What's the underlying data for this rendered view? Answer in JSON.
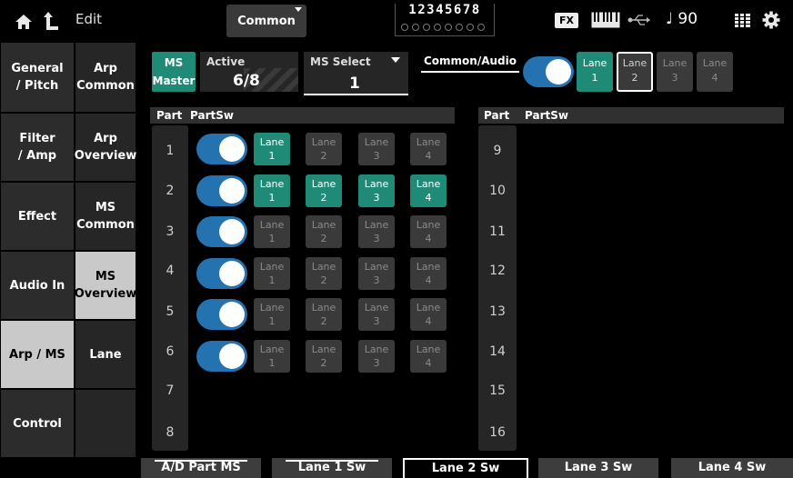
{
  "topbar": {
    "edit_label": "Edit",
    "common_label": "Common",
    "part_digits": "12345678",
    "fx_label": "FX",
    "tempo": "♩ 90"
  },
  "nav": {
    "col1": [
      {
        "label": "General\n/ Pitch",
        "active": false
      },
      {
        "label": "Filter\n/ Amp",
        "active": false
      },
      {
        "label": "Effect",
        "active": false
      },
      {
        "label": "Audio In",
        "active": false
      },
      {
        "label": "Arp / MS",
        "active": true
      },
      {
        "label": "Control",
        "active": false
      }
    ],
    "col2": [
      {
        "label": "Arp\nCommon",
        "active": false
      },
      {
        "label": "Arp\nOverview",
        "active": false
      },
      {
        "label": "MS\nCommon",
        "active": false
      },
      {
        "label": "MS\nOverview",
        "active": true
      },
      {
        "label": "Lane",
        "active": false
      }
    ]
  },
  "header": {
    "ms_master_label": "MS\nMaster",
    "active_caption": "Active",
    "active_value": "6/8",
    "ms_select_caption": "MS Select",
    "ms_select_value": "1",
    "common_audio_label": "Common/Audio",
    "common_audio_switch": "on",
    "lanes": [
      {
        "label": "Lane",
        "num": "1",
        "state": "on"
      },
      {
        "label": "Lane",
        "num": "2",
        "state": "selected"
      },
      {
        "label": "Lane",
        "num": "3",
        "state": "off"
      },
      {
        "label": "Lane",
        "num": "4",
        "state": "off"
      }
    ]
  },
  "table": {
    "part_header": "Part",
    "partsw_header": "PartSw",
    "left_parts": [
      "1",
      "2",
      "3",
      "4",
      "5",
      "6",
      "7",
      "8"
    ],
    "right_parts": [
      "9",
      "10",
      "11",
      "12",
      "13",
      "14",
      "15",
      "16"
    ],
    "rows": [
      {
        "switch": "on",
        "lanes": [
          {
            "label": "Lane",
            "num": "1",
            "on": true
          },
          {
            "label": "Lane",
            "num": "2",
            "on": false
          },
          {
            "label": "Lane",
            "num": "3",
            "on": false
          },
          {
            "label": "Lane",
            "num": "4",
            "on": false
          }
        ]
      },
      {
        "switch": "on",
        "lanes": [
          {
            "label": "Lane",
            "num": "1",
            "on": true
          },
          {
            "label": "Lane",
            "num": "2",
            "on": true
          },
          {
            "label": "Lane",
            "num": "3",
            "on": true
          },
          {
            "label": "Lane",
            "num": "4",
            "on": true
          }
        ]
      },
      {
        "switch": "on",
        "lanes": [
          {
            "label": "Lane",
            "num": "1",
            "on": false
          },
          {
            "label": "Lane",
            "num": "2",
            "on": false
          },
          {
            "label": "Lane",
            "num": "3",
            "on": false
          },
          {
            "label": "Lane",
            "num": "4",
            "on": false
          }
        ]
      },
      {
        "switch": "on",
        "lanes": [
          {
            "label": "Lane",
            "num": "1",
            "on": false
          },
          {
            "label": "Lane",
            "num": "2",
            "on": false
          },
          {
            "label": "Lane",
            "num": "3",
            "on": false
          },
          {
            "label": "Lane",
            "num": "4",
            "on": false
          }
        ]
      },
      {
        "switch": "on",
        "lanes": [
          {
            "label": "Lane",
            "num": "1",
            "on": false
          },
          {
            "label": "Lane",
            "num": "2",
            "on": false
          },
          {
            "label": "Lane",
            "num": "3",
            "on": false
          },
          {
            "label": "Lane",
            "num": "4",
            "on": false
          }
        ]
      },
      {
        "switch": "on",
        "lanes": [
          {
            "label": "Lane",
            "num": "1",
            "on": false
          },
          {
            "label": "Lane",
            "num": "2",
            "on": false
          },
          {
            "label": "Lane",
            "num": "3",
            "on": false
          },
          {
            "label": "Lane",
            "num": "4",
            "on": false
          }
        ]
      }
    ]
  },
  "tabs": [
    {
      "label": "A/D Part MS",
      "active": false
    },
    {
      "label": "Lane 1 Sw",
      "active": false
    },
    {
      "label": "Lane 2 Sw",
      "active": true
    },
    {
      "label": "Lane 3 Sw",
      "active": false
    },
    {
      "label": "Lane 4 Sw",
      "active": false
    }
  ],
  "colors": {
    "accent_teal": "#1f8a76",
    "switch_blue": "#2473b0",
    "button_gray": "#3a3a3a",
    "panel_gray": "#262626"
  },
  "icons": [
    "home-icon",
    "up-arrow-icon",
    "dropdown-arrow-icon",
    "keyboard-icon",
    "usb-icon",
    "grid-icon",
    "gear-icon"
  ]
}
